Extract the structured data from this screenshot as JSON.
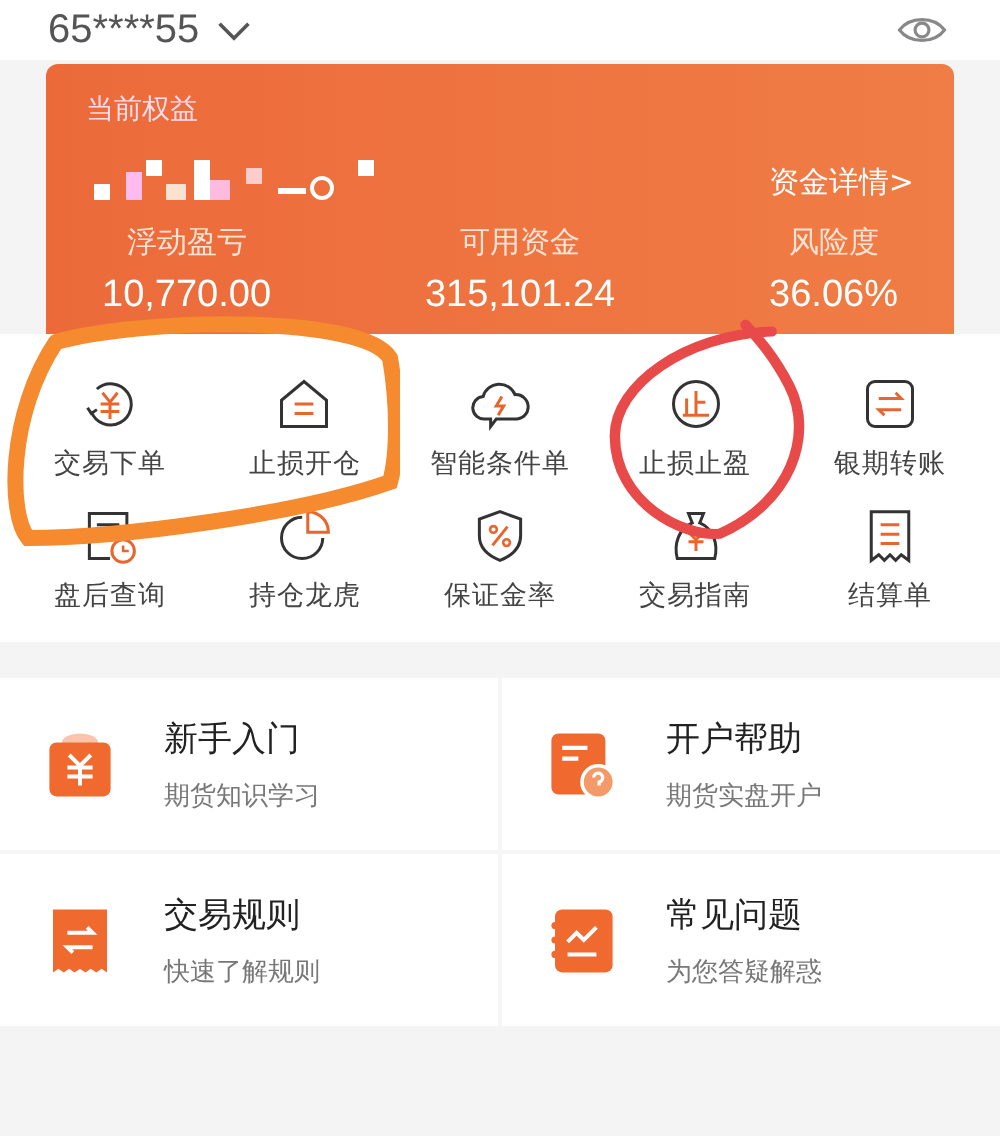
{
  "account": {
    "number": "65****55"
  },
  "equity_card": {
    "title": "当前权益",
    "details_link": "资金详情>",
    "stats": [
      {
        "label": "浮动盈亏",
        "value": "10,770.00"
      },
      {
        "label": "可用资金",
        "value": "315,101.24"
      },
      {
        "label": "风险度",
        "value": "36.06%"
      }
    ]
  },
  "shortcuts": [
    {
      "label": "交易下单",
      "kind": "yuan-cycle"
    },
    {
      "label": "止损开仓",
      "kind": "house"
    },
    {
      "label": "智能条件单",
      "kind": "cloud"
    },
    {
      "label": "止损止盈",
      "kind": "stop"
    },
    {
      "label": "银期转账",
      "kind": "transfer"
    },
    {
      "label": "盘后查询",
      "kind": "doc-clock"
    },
    {
      "label": "持仓龙虎",
      "kind": "pie"
    },
    {
      "label": "保证金率",
      "kind": "shield"
    },
    {
      "label": "交易指南",
      "kind": "bag"
    },
    {
      "label": "结算单",
      "kind": "receipt"
    }
  ],
  "guides": [
    {
      "title": "新手入门",
      "subtitle": "期货知识学习",
      "kind": "yuan"
    },
    {
      "title": "开户帮助",
      "subtitle": "期货实盘开户",
      "kind": "help"
    },
    {
      "title": "交易规则",
      "subtitle": "快速了解规则",
      "kind": "swap"
    },
    {
      "title": "常见问题",
      "subtitle": "为您答疑解惑",
      "kind": "chart"
    }
  ]
}
